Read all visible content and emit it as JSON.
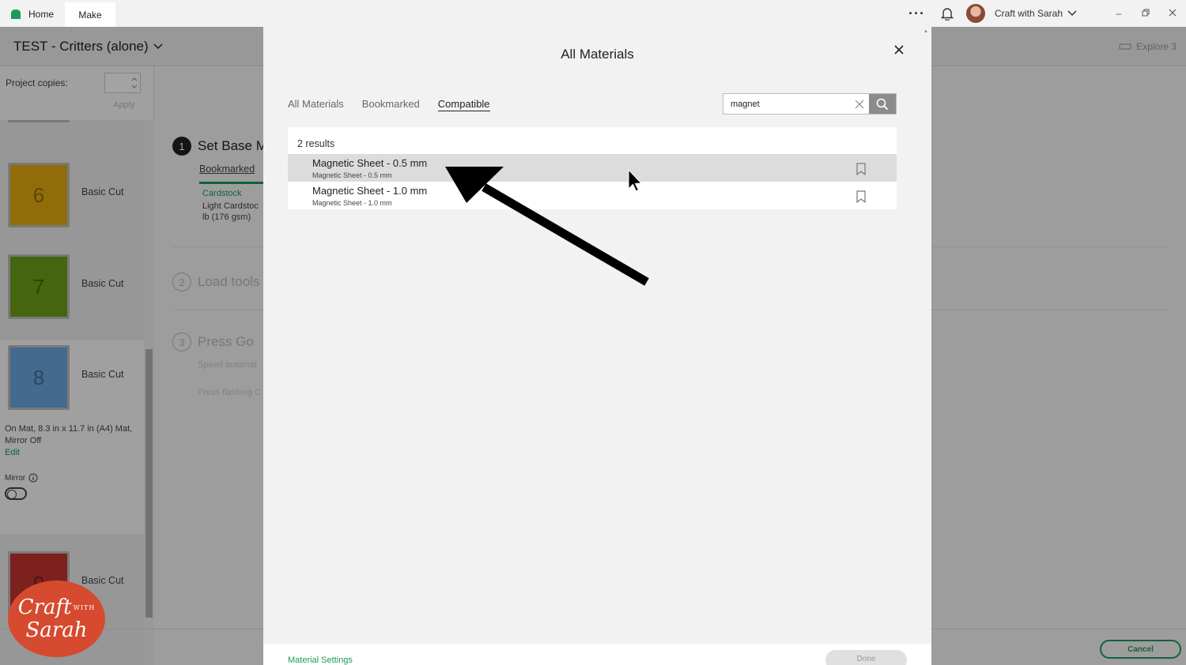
{
  "titlebar": {
    "home_label": "Home",
    "make_label": "Make",
    "user_name": "Craft with Sarah",
    "brand_color": "#1a9b5c"
  },
  "project": {
    "title": "TEST - Critters (alone)",
    "explore_label": "Explore 3",
    "copies_label": "Project copies:",
    "apply_label": "Apply"
  },
  "mats": [
    {
      "number": "6",
      "label": "Basic Cut",
      "color": "#e3a90f"
    },
    {
      "number": "7",
      "label": "Basic Cut",
      "color": "#6e9e18"
    },
    {
      "number": "8",
      "label": "Basic Cut",
      "color": "#6aa7e0"
    },
    {
      "number": "9",
      "label": "Basic Cut",
      "color": "#c2352e"
    }
  ],
  "mat_info": {
    "line1": "On Mat, 8.3 in x 11.7 in (A4) Mat,",
    "line2": "Mirror Off",
    "edit_label": "Edit",
    "mirror_label": "Mirror"
  },
  "steps": {
    "s1": {
      "number": "1",
      "title": "Set Base M"
    },
    "s1_tab": "Bookmarked",
    "s1_material_type": "Cardstock",
    "s1_material_line1": "Light Cardstoc",
    "s1_material_line2": "lb (176 gsm)",
    "s2": {
      "number": "2",
      "title": "Load tools"
    },
    "s3": {
      "number": "3",
      "title": "Press Go"
    },
    "s3_line1": "Speed automat",
    "s3_line2": "Press flashing C"
  },
  "footer": {
    "cancel_label": "Cancel"
  },
  "modal": {
    "title": "All Materials",
    "tabs": [
      {
        "label": "All Materials",
        "active": false
      },
      {
        "label": "Bookmarked",
        "active": false
      },
      {
        "label": "Compatible",
        "active": true
      }
    ],
    "search_value": "magnet",
    "results_count": "2 results",
    "results": [
      {
        "name": "Magnetic Sheet - 0.5 mm",
        "sub": "Magnetic Sheet - 0.5 mm",
        "highlighted": true
      },
      {
        "name": "Magnetic Sheet - 1.0 mm",
        "sub": "Magnetic Sheet - 1.0 mm",
        "highlighted": false
      }
    ],
    "material_settings_label": "Material Settings",
    "done_label": "Done"
  },
  "watermark": {
    "line1": "Craft",
    "with": "WITH",
    "line2": "Sarah",
    "color": "#d64a2f"
  }
}
